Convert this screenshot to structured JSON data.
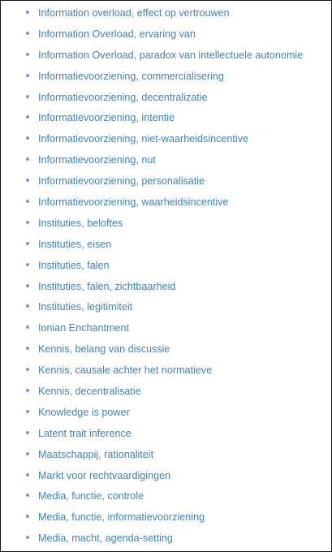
{
  "items": [
    "Information overload, effect op vertrouwen",
    "Information Overload, ervaring van",
    "Information Overload, paradox van intellectuele autonomie",
    "Informatievoorziening, commercialisering",
    "Informatievoorziening, decentralizatie",
    "Informatievoorziening, intentie",
    "Informatievoorziening, niet-waarheidsincentive",
    "Informatievoorziening, nut",
    "Informatievoorziening, personalisatie",
    "Informatievoorziening, waarheidsincentive",
    "Instituties, beloftes",
    "Instituties, eisen",
    "Instituties, falen",
    "Instituties, falen, zichtbaarheid",
    "Instituties, legitimiteit",
    "Ionian Enchantment",
    "Kennis, belang van discussie",
    "Kennis, causale achter het normatieve",
    "Kennis, decentralisatie",
    "Knowledge is power",
    "Latent trait inference",
    "Maatschappij, rationaliteit",
    "Markt voor rechtvaardigingen",
    "Media, functie, controle",
    "Media, functie, informatievoorziening",
    "Media, macht, agenda-setting"
  ],
  "colors": {
    "link": "#3f84b8",
    "bullet": "#a97ad8"
  }
}
